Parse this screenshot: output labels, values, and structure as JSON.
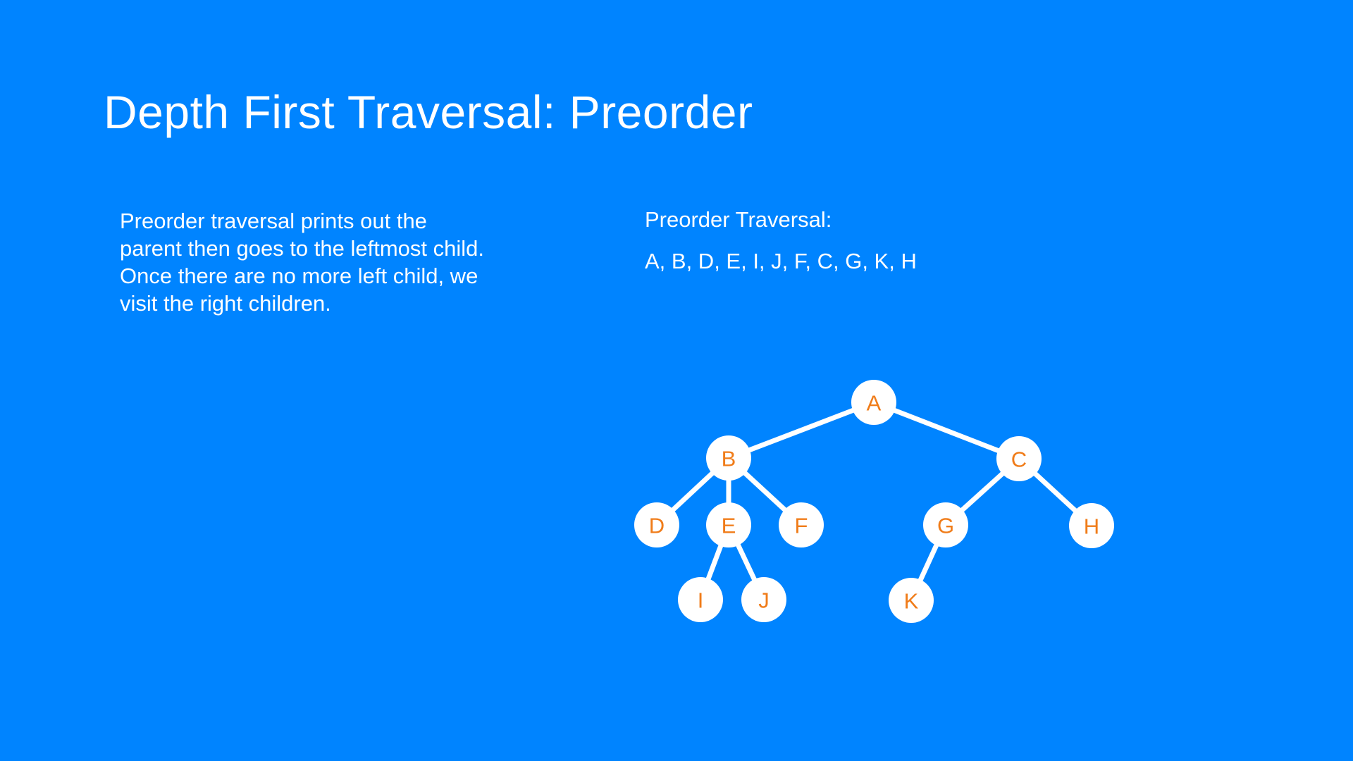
{
  "slide": {
    "title": "Depth First Traversal: Preorder",
    "description_lines": [
      "Preorder traversal prints out the",
      "parent then goes to the leftmost child.",
      "Once there are no more left child, we",
      "visit the right children."
    ],
    "traversal_label": "Preorder Traversal:",
    "traversal_sequence": "A, B, D, E, I, J, F, C, G, K, H"
  },
  "tree": {
    "colors": {
      "background": "#0084ff",
      "node_fill": "#ffffff",
      "edge": "#ffffff",
      "label": "#f07c19"
    },
    "nodes": [
      {
        "id": "A",
        "label": "A"
      },
      {
        "id": "B",
        "label": "B"
      },
      {
        "id": "C",
        "label": "C"
      },
      {
        "id": "D",
        "label": "D"
      },
      {
        "id": "E",
        "label": "E"
      },
      {
        "id": "F",
        "label": "F"
      },
      {
        "id": "G",
        "label": "G"
      },
      {
        "id": "H",
        "label": "H"
      },
      {
        "id": "I",
        "label": "I"
      },
      {
        "id": "J",
        "label": "J"
      },
      {
        "id": "K",
        "label": "K"
      }
    ],
    "edges": [
      {
        "from": "A",
        "to": "B"
      },
      {
        "from": "A",
        "to": "C"
      },
      {
        "from": "B",
        "to": "D"
      },
      {
        "from": "B",
        "to": "E"
      },
      {
        "from": "B",
        "to": "F"
      },
      {
        "from": "E",
        "to": "I"
      },
      {
        "from": "E",
        "to": "J"
      },
      {
        "from": "C",
        "to": "G"
      },
      {
        "from": "C",
        "to": "H"
      },
      {
        "from": "G",
        "to": "K"
      }
    ]
  }
}
